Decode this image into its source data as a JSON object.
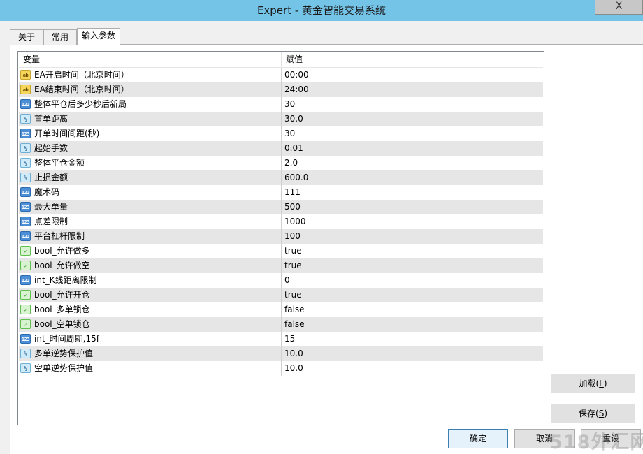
{
  "window": {
    "title": "Expert - 黄金智能交易系统",
    "close_label": "X"
  },
  "tabs": [
    {
      "label": "关于"
    },
    {
      "label": "常用"
    },
    {
      "label": "输入参数"
    }
  ],
  "table": {
    "headers": {
      "variable": "变量",
      "value": "赋值"
    },
    "rows": [
      {
        "type_icon": "ab",
        "variable": "EA开启时间（北京时间）",
        "value": "00:00"
      },
      {
        "type_icon": "ab",
        "variable": "EA结束时间（北京时间）",
        "value": "24:00"
      },
      {
        "type_icon": "123",
        "variable": "整体平仓后多少秒后新局",
        "value": "30"
      },
      {
        "type_icon": "½",
        "variable": "首单距离",
        "value": "30.0"
      },
      {
        "type_icon": "123",
        "variable": "开单时间间距(秒)",
        "value": "30"
      },
      {
        "type_icon": "½",
        "variable": "起始手数",
        "value": "0.01"
      },
      {
        "type_icon": "½",
        "variable": "整体平仓金额",
        "value": "2.0"
      },
      {
        "type_icon": "½",
        "variable": "止损金额",
        "value": "600.0"
      },
      {
        "type_icon": "123",
        "variable": "魔术码",
        "value": "111"
      },
      {
        "type_icon": "123",
        "variable": "最大单量",
        "value": "500"
      },
      {
        "type_icon": "123",
        "variable": "点差限制",
        "value": "1000"
      },
      {
        "type_icon": "123",
        "variable": "平台杠杆限制",
        "value": "100"
      },
      {
        "type_icon": "✓",
        "variable": "bool_允许做多",
        "value": "true"
      },
      {
        "type_icon": "✓",
        "variable": "bool_允许做空",
        "value": "true"
      },
      {
        "type_icon": "123",
        "variable": "int_K线距离限制",
        "value": "0"
      },
      {
        "type_icon": "✓",
        "variable": "bool_允许开仓",
        "value": "true"
      },
      {
        "type_icon": "✓",
        "variable": "bool_多单锁仓",
        "value": "false"
      },
      {
        "type_icon": "✓",
        "variable": "bool_空单锁仓",
        "value": "false"
      },
      {
        "type_icon": "123",
        "variable": "int_时间周期,15f",
        "value": "15"
      },
      {
        "type_icon": "½",
        "variable": "多单逆势保护值",
        "value": "10.0"
      },
      {
        "type_icon": "½",
        "variable": "空单逆势保护值",
        "value": "10.0"
      }
    ]
  },
  "buttons": {
    "load": {
      "label": "加载(",
      "key": "L",
      "suffix": ")"
    },
    "save": {
      "label": "保存(",
      "key": "S",
      "suffix": ")"
    },
    "ok": "确定",
    "cancel": "取消",
    "reset": "重设"
  },
  "watermark": "518外汇网",
  "colors": {
    "titlebar": "#74c4e8",
    "row_alt": "#e6e6e6",
    "string_icon": "#f6d65a",
    "int_icon": "#4d8fd6",
    "double_icon": "#cfeaf9",
    "bool_icon": "#5fbf4f"
  }
}
